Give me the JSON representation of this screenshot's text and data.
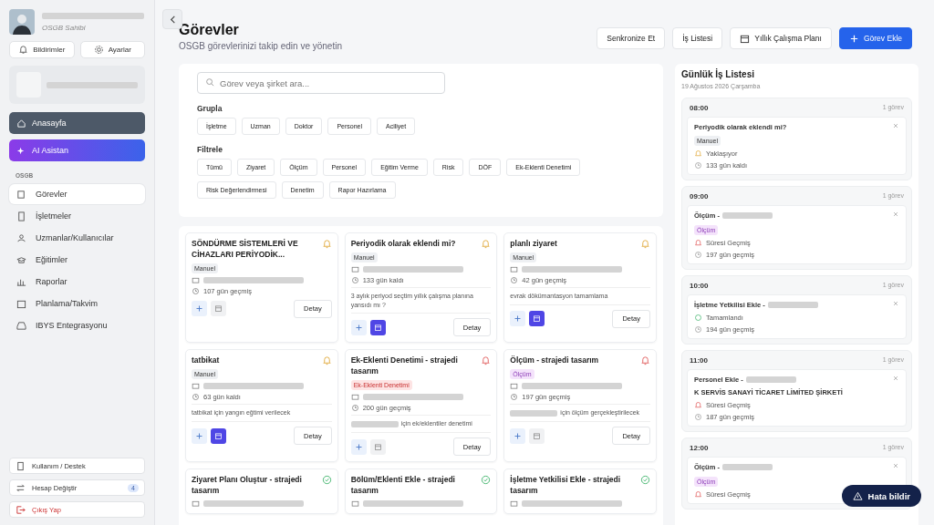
{
  "profile": {
    "role": "OSGB Sahibi"
  },
  "top_buttons": [
    "Bildirimler",
    "Ayarlar"
  ],
  "quick": [
    {
      "label": "Anasayfa",
      "kind": "home"
    },
    {
      "label": "AI Asistan",
      "kind": "ai"
    }
  ],
  "section": "OSGB",
  "nav": [
    {
      "label": "Görevler",
      "selected": true
    },
    {
      "label": "İşletmeler",
      "selected": false
    },
    {
      "label": "Uzmanlar/Kullanıcılar",
      "selected": false
    },
    {
      "label": "Eğitimler",
      "selected": false
    },
    {
      "label": "Raporlar",
      "selected": false
    },
    {
      "label": "Planlama/Takvim",
      "selected": false
    },
    {
      "label": "IBYS Entegrasyonu",
      "selected": false
    }
  ],
  "bottom": [
    {
      "label": "Kullanım / Destek",
      "kind": "help"
    },
    {
      "label": "Hesap Değiştir",
      "kind": "switch",
      "badge": "4"
    },
    {
      "label": "Çıkış Yap",
      "kind": "logout"
    }
  ],
  "header": {
    "title": "Görevler",
    "subtitle": "OSGB görevlerinizi takip edin ve yönetin"
  },
  "actions": [
    {
      "label": "Senkronize Et",
      "kind": "plain"
    },
    {
      "label": "İş Listesi",
      "kind": "plain"
    },
    {
      "label": "Yıllık Çalışma Planı",
      "kind": "calendar"
    },
    {
      "label": "Görev Ekle",
      "kind": "primary"
    }
  ],
  "search": {
    "placeholder": "Görev veya şirket ara..."
  },
  "group": {
    "label": "Grupla",
    "options": [
      "İşletme",
      "Uzman",
      "Doktor",
      "Personel",
      "Aciliyet"
    ]
  },
  "filter": {
    "label": "Filtrele",
    "options": [
      "Tümü",
      "Ziyaret",
      "Ölçüm",
      "Personel",
      "Eğitim Verme",
      "Risk",
      "DÖF",
      "Ek-Eklenti Denetimi",
      "Risk Değerlendirmesi",
      "Denetim",
      "Rapor Hazırlama"
    ]
  },
  "cards": [
    {
      "title": "SÖNDÜRME SİSTEMLERİ VE CİHAZLARI PERİYODİK...",
      "kind": "warning",
      "tag": {
        "label": "Manuel",
        "kind": "manual"
      },
      "time": "107 gün geçmiş",
      "calendar_active": false,
      "button": "Detay"
    },
    {
      "title": "Periyodik olarak eklendi mi?",
      "kind": "warning",
      "tag": {
        "label": "Manuel",
        "kind": "manual"
      },
      "time": "133 gün kaldı",
      "note": "3 aylık periyod seçtim yıllık çalışma planına yansıdı mı ?",
      "calendar_active": true,
      "button": "Detay"
    },
    {
      "title": "planlı ziyaret",
      "kind": "warning",
      "tag": {
        "label": "Manuel",
        "kind": "manual"
      },
      "time": "42 gün geçmiş",
      "note": "evrak dökümantasyon tamamlama",
      "calendar_active": true,
      "button": "Detay"
    },
    {
      "title": "tatbikat",
      "kind": "warning",
      "tag": {
        "label": "Manuel",
        "kind": "manual"
      },
      "time": "63 gün kaldı",
      "note": "tatbikat için yangın eğtimi verilecek",
      "calendar_active": true,
      "button": "Detay"
    },
    {
      "title": "Ek-Eklenti Denetimi - strajedi tasarım",
      "kind": "overdue",
      "tag": {
        "label": "Ek-Eklenti Denetimi",
        "kind": "danger"
      },
      "time": "200 gün geçmiş",
      "note": "için ek/eklentiler denetimi",
      "note_redacted": true,
      "calendar_active": false,
      "button": "Detay"
    },
    {
      "title": "Ölçüm - strajedi tasarım",
      "kind": "overdue",
      "tag": {
        "label": "Ölçüm",
        "kind": "measure"
      },
      "time": "197 gün geçmiş",
      "note": "için ölçüm gerçekleştirilecek",
      "note_redacted": true,
      "calendar_active": false,
      "button": "Detay"
    },
    {
      "title": "Ziyaret Planı Oluştur - strajedi tasarım",
      "kind": "done"
    },
    {
      "title": "Bölüm/Eklenti Ekle - strajedi tasarım",
      "kind": "done"
    },
    {
      "title": "İşletme Yetkilisi Ekle - strajedi tasarım",
      "kind": "done"
    }
  ],
  "daily": {
    "title": "Günlük İş Listesi",
    "date": "19 Ağustos 2026 Çarşamba",
    "slots": [
      {
        "time": "08:00",
        "count": "1 görev",
        "task": {
          "title": "Periyodik olarak eklendi mi?",
          "tag": {
            "label": "Manuel",
            "kind": "manual"
          },
          "status": {
            "label": "Yaklaşıyor",
            "kind": "warning"
          },
          "time": "133 gün kaldı"
        }
      },
      {
        "time": "09:00",
        "count": "1 görev",
        "task": {
          "title": "Ölçüm -",
          "redacted": true,
          "tag": {
            "label": "Ölçüm",
            "kind": "measure"
          },
          "status": {
            "label": "Süresi Geçmiş",
            "kind": "overdue"
          },
          "time": "197 gün geçmiş"
        }
      },
      {
        "time": "10:00",
        "count": "1 görev",
        "task": {
          "title": "İşletme Yetkilisi Ekle -",
          "redacted": true,
          "status": {
            "label": "Tamamlandı",
            "kind": "done"
          },
          "time": "194 gün geçmiş"
        }
      },
      {
        "time": "11:00",
        "count": "1 görev",
        "task": {
          "title": "Personel Ekle -",
          "redacted": true,
          "suffix": "K SERVİS SANAYİ TİCARET LİMİTED ŞİRKETİ",
          "status": {
            "label": "Süresi Geçmiş",
            "kind": "overdue"
          },
          "time": "187 gün geçmiş"
        }
      },
      {
        "time": "12:00",
        "count": "1 görev",
        "task": {
          "title": "Ölçüm -",
          "redacted": true,
          "tag": {
            "label": "Ölçüm",
            "kind": "measure"
          },
          "status": {
            "label": "Süresi Geçmiş",
            "kind": "overdue"
          }
        }
      }
    ]
  },
  "report_button": "Hata bildir"
}
